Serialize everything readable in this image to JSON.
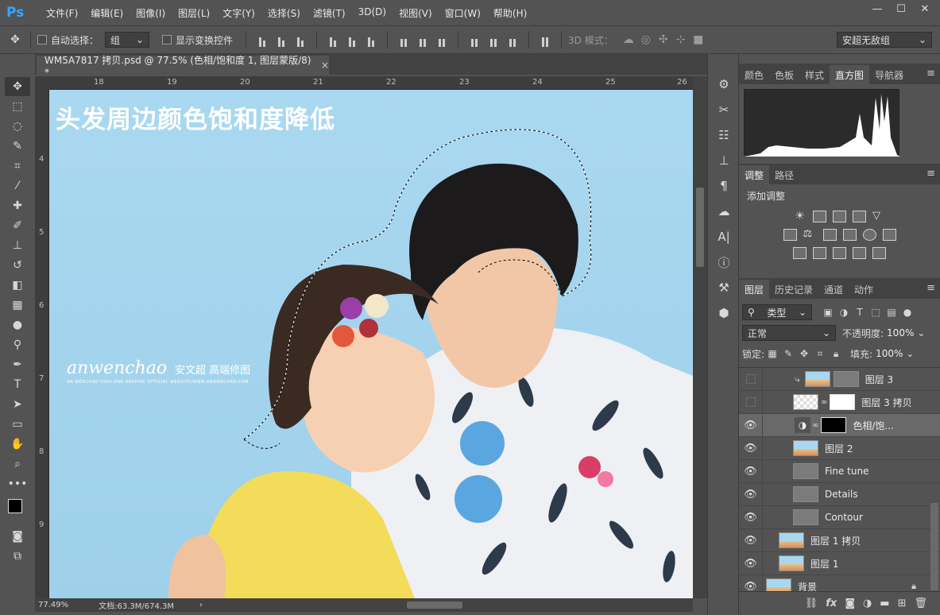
{
  "app": {
    "logo": "Ps",
    "menu": [
      "文件(F)",
      "编辑(E)",
      "图像(I)",
      "图层(L)",
      "文字(Y)",
      "选择(S)",
      "滤镜(T)",
      "3D(D)",
      "视图(V)",
      "窗口(W)",
      "帮助(H)"
    ],
    "window_controls": [
      "minimize-icon",
      "maximize-icon",
      "close-icon"
    ]
  },
  "options": {
    "auto_select_label": "自动选择：",
    "auto_select_value": "组",
    "show_transform_label": "显示变换控件",
    "mode_3d_label": "3D 模式：",
    "workspace": "安超无敌组"
  },
  "document": {
    "tab_title": "WM5A7817 拷贝.psd @ 77.5% (色相/饱和度 1, 图层蒙版/8) *",
    "tab_close": "×",
    "ruler_top": [
      "18",
      "19",
      "20",
      "21",
      "22",
      "23",
      "24",
      "25",
      "26"
    ],
    "ruler_left": [
      "4",
      "5",
      "6",
      "7",
      "8",
      "9"
    ],
    "canvas_title": "头发周边颜色饱和度降低",
    "watermark_main": "anwenchao",
    "watermark_cn": "安文超 高端修图",
    "watermark_sub": "AN WENCHAO HIGH-END GRAPHIC OFFICIAL WEBSITE/WWW.ANWENCHAO.COM",
    "zoom": "77.49%",
    "doc_size": "文档:63.3M/674.3M"
  },
  "panels": {
    "top_tabs": [
      "颜色",
      "色板",
      "样式",
      "直方图",
      "导航器"
    ],
    "top_active": "直方图",
    "adj_tabs": [
      "调整",
      "路径"
    ],
    "adj_active": "调整",
    "adj_title": "添加调整",
    "layer_tabs": [
      "图层",
      "历史记录",
      "通道",
      "动作"
    ],
    "layer_active": "图层",
    "filter_label": "类型",
    "blend_mode": "正常",
    "opacity_label": "不透明度:",
    "opacity_value": "100%",
    "lock_label": "锁定:",
    "fill_label": "填充:",
    "fill_value": "100%"
  },
  "layers": [
    {
      "name": "图层 3",
      "visible": false,
      "thumb": "photo-gray",
      "indent": 1,
      "clip": true
    },
    {
      "name": "图层 3 拷贝",
      "visible": false,
      "thumb": "photo-mask",
      "indent": 1
    },
    {
      "name": "色相/饱...",
      "visible": true,
      "thumb": "adj-mask",
      "indent": 1,
      "selected": true
    },
    {
      "name": "图层 2",
      "visible": true,
      "thumb": "photo",
      "indent": 1
    },
    {
      "name": "Fine tune",
      "visible": true,
      "thumb": "gray",
      "indent": 1
    },
    {
      "name": "Details",
      "visible": true,
      "thumb": "gray",
      "indent": 1
    },
    {
      "name": "Contour",
      "visible": true,
      "thumb": "gray",
      "indent": 1
    },
    {
      "name": "图层 1 拷贝",
      "visible": true,
      "thumb": "photo",
      "indent": 0
    },
    {
      "name": "图层 1",
      "visible": true,
      "thumb": "photo",
      "indent": 0
    },
    {
      "name": "背景",
      "visible": true,
      "thumb": "photo",
      "indent": 0,
      "locked": true
    }
  ],
  "colors": {
    "ui_bg": "#535353",
    "canvas_sky": "#a6d6ee",
    "accent_ps": "#31a8ff"
  }
}
